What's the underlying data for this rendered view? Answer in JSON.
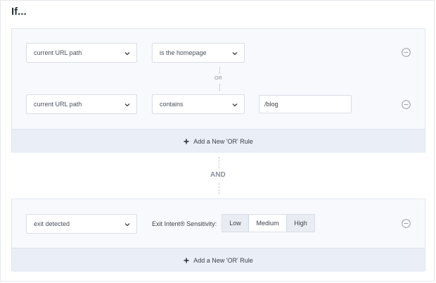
{
  "header": {
    "title": "If..."
  },
  "rule_group_1": {
    "rules": [
      {
        "field": "current URL path",
        "operator": "is the homepage"
      },
      {
        "field": "current URL path",
        "operator": "contains",
        "value": "/blog"
      }
    ],
    "or_label": "OR",
    "add_rule_label": "Add a New 'OR' Rule"
  },
  "and_label": "AND",
  "rule_group_2": {
    "rules": [
      {
        "field": "exit detected",
        "sensitivity_label": "Exit Intent® Sensitivity:",
        "options": [
          "Low",
          "Medium",
          "High"
        ],
        "selected": "Medium"
      }
    ],
    "add_rule_label": "Add a New 'OR' Rule"
  },
  "icons": {
    "dropdown": "chevron-down-icon",
    "remove": "minus-circle-icon",
    "add": "plus-icon"
  },
  "colors": {
    "group_bg": "#f7f9fc",
    "add_bar_bg": "#e9eef7",
    "border": "#d9dee6",
    "text": "#3a3f47"
  }
}
